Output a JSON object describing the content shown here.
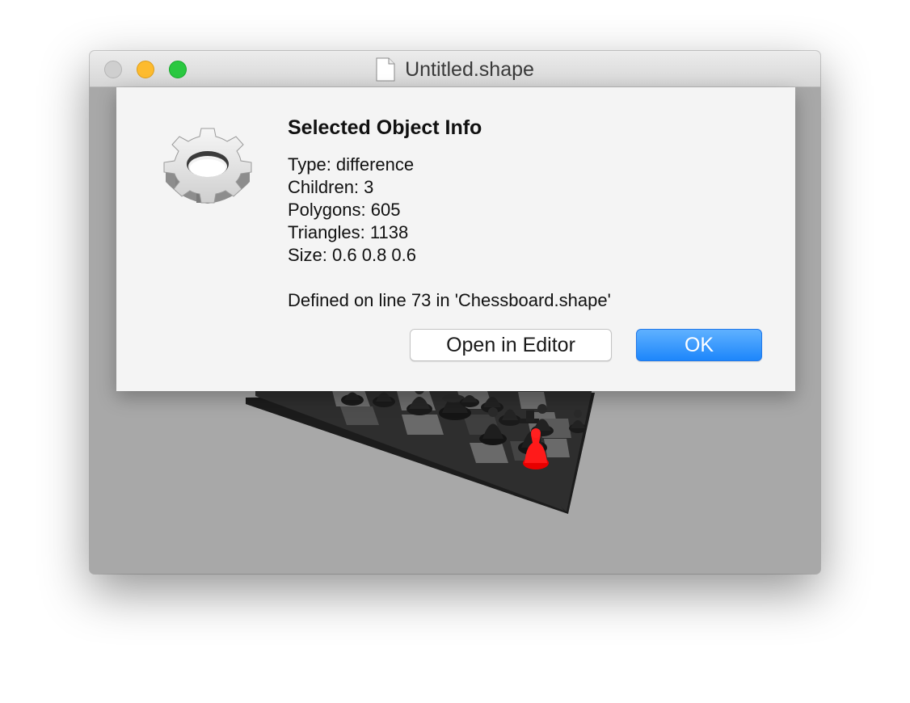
{
  "window": {
    "title": "Untitled.shape",
    "buttons": [
      "close",
      "minimize",
      "zoom"
    ]
  },
  "dialog": {
    "heading": "Selected Object Info",
    "icon": "gear-icon",
    "info_lines": [
      "Type: difference",
      "Children: 3",
      "Polygons: 605",
      "Triangles: 1138",
      "Size: 0.6 0.8 0.6"
    ],
    "defined": "Defined on line 73 in 'Chessboard.shape'",
    "open_editor_label": "Open in Editor",
    "ok_label": "OK"
  },
  "colors": {
    "accent": "#1d86fb",
    "selected_piece": "#ff0000",
    "viewport_background": "#a8a8a8"
  }
}
